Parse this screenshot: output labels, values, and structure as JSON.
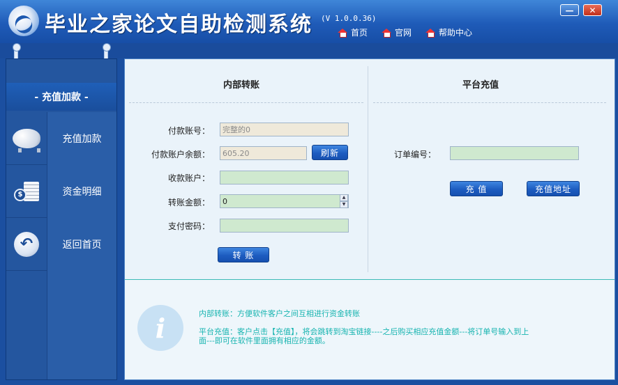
{
  "titlebar": {
    "title": "毕业之家论文自助检测系统",
    "version": "(V 1.0.0.36)",
    "nav": [
      {
        "label": "首页",
        "icon": "home-icon"
      },
      {
        "label": "官网",
        "icon": "home-icon"
      },
      {
        "label": "帮助中心",
        "icon": "home-icon"
      }
    ],
    "min_label": "—",
    "close_label": "✕"
  },
  "sidebar": {
    "header": "- 充值加款 -",
    "items": [
      {
        "label": "充值加款",
        "icon": "piggy-bank-icon"
      },
      {
        "label": "资金明细",
        "icon": "money-icon"
      },
      {
        "label": "返回首页",
        "icon": "back-arrow-icon"
      }
    ]
  },
  "transfer": {
    "title": "内部转账",
    "payer_label": "付款账号：",
    "payer_value": "完整的0",
    "balance_label": "付款账户余额：",
    "balance_value": "605.20",
    "refresh_label": "刷新",
    "payee_label": "收款账户：",
    "payee_value": "",
    "amount_label": "转账金额：",
    "amount_value": "0",
    "password_label": "支付密码：",
    "password_value": "",
    "submit_label": "转 账"
  },
  "recharge": {
    "title": "平台充值",
    "order_label": "订单编号：",
    "order_value": "",
    "recharge_label": "充 值",
    "address_label": "充值地址"
  },
  "info": {
    "line1": "内部转账：方便软件客户之间互相进行资金转账",
    "line2": "平台充值：客户点击【充值】，将会跳转到淘宝链接----之后购买相应充值金额---将订单号输入到上",
    "line3": "面---即可在软件里面拥有相应的金额。",
    "icon_glyph": "i"
  },
  "colors": {
    "title_blue": "#1f5bb8",
    "accent_teal": "#17b4b0",
    "field_green": "#cfe9cf"
  }
}
